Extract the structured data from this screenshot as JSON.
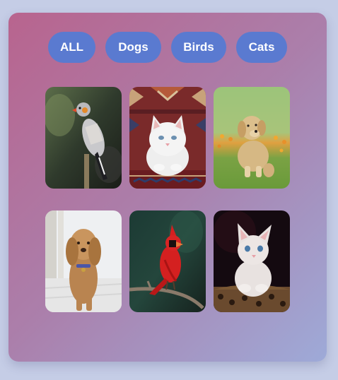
{
  "filters": [
    {
      "label": "ALL"
    },
    {
      "label": "Dogs"
    },
    {
      "label": "Birds"
    },
    {
      "label": "Cats"
    }
  ],
  "gallery": [
    {
      "name": "zebra-finch-bird",
      "category": "Birds"
    },
    {
      "name": "white-kitten-on-rug",
      "category": "Cats"
    },
    {
      "name": "golden-puppy-in-flowers",
      "category": "Dogs"
    },
    {
      "name": "fluffy-doodle-dog",
      "category": "Dogs"
    },
    {
      "name": "red-cardinal-bird",
      "category": "Birds"
    },
    {
      "name": "white-kitten-in-basket",
      "category": "Cats"
    }
  ],
  "colors": {
    "page_background": "#c5cde6",
    "card_gradient": [
      "#b8648e",
      "#9eaad8"
    ],
    "button_background": "#5a7ad0",
    "button_text": "#ffffff"
  }
}
